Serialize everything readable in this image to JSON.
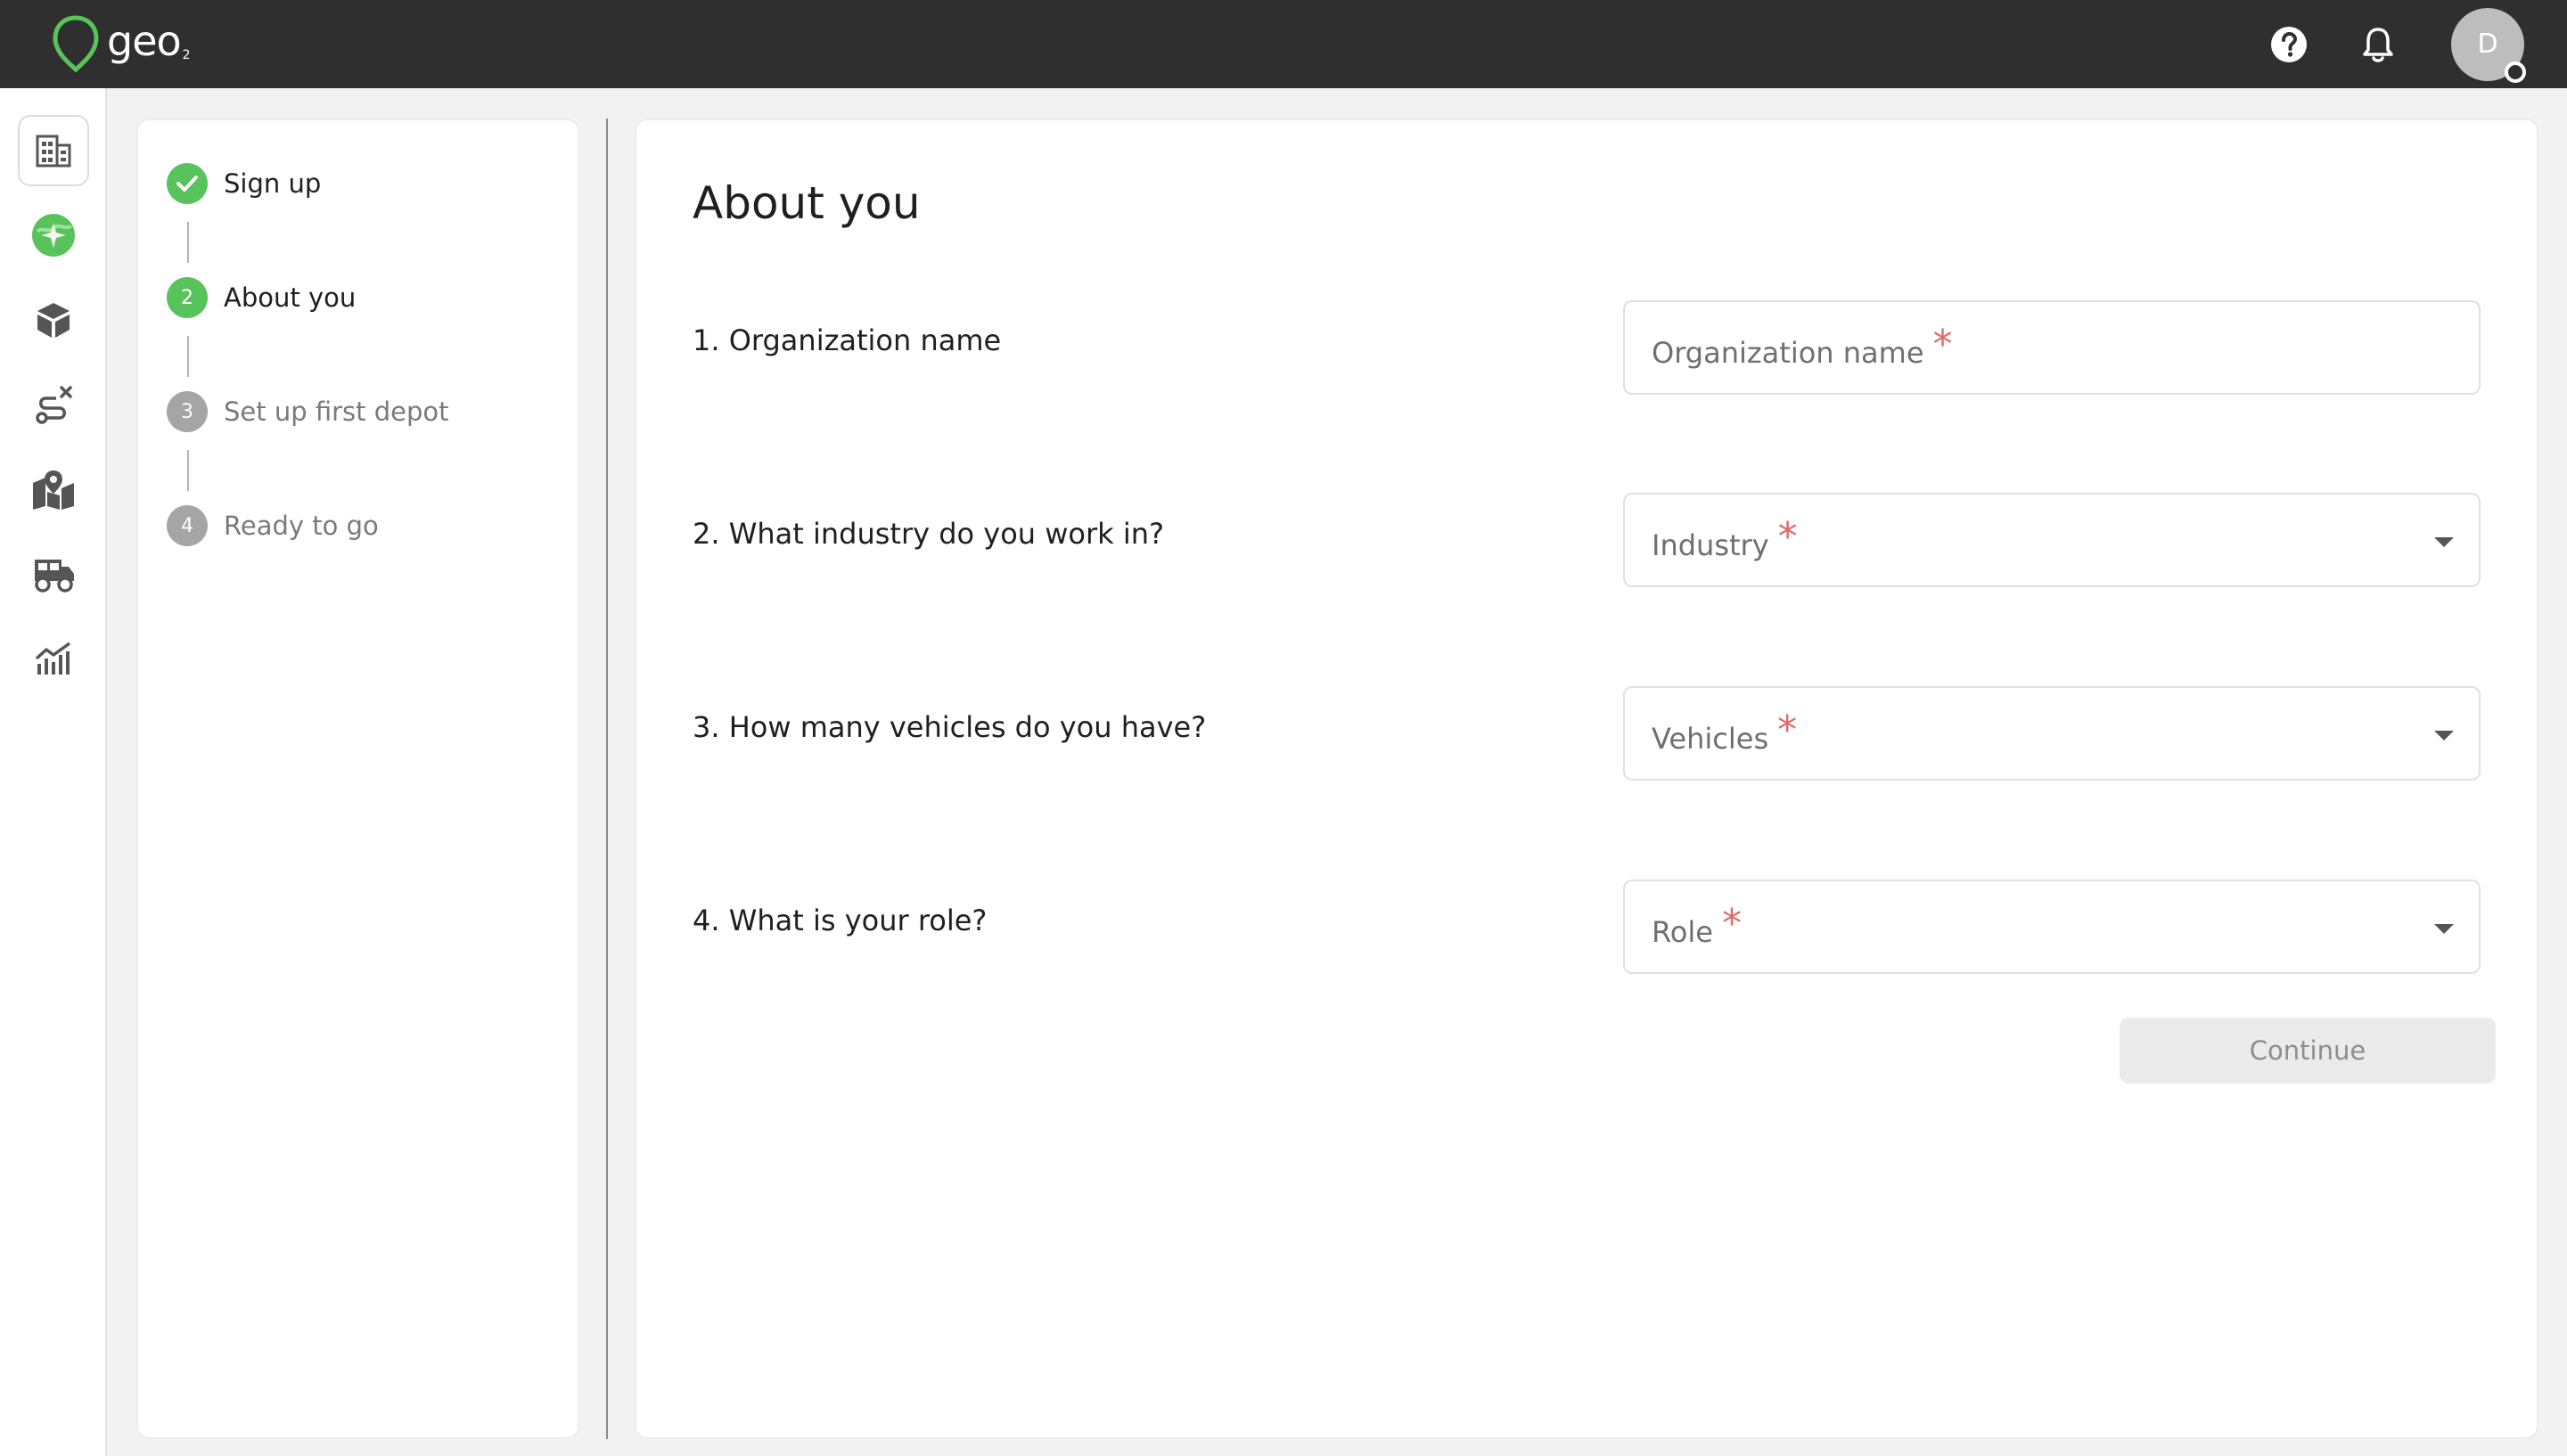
{
  "app": {
    "logo_text": "geo",
    "logo_sub": "2",
    "brand_color": "#58c35b",
    "topbar_color": "#2f2f2f"
  },
  "header": {
    "help_icon": "help-circle-icon",
    "notifications_icon": "bell-icon",
    "avatar_initial": "D"
  },
  "sidebar": {
    "items": [
      {
        "icon": "building-icon",
        "active": true
      },
      {
        "icon": "globe-sparkle-icon",
        "active": false
      },
      {
        "icon": "package-icon",
        "active": false
      },
      {
        "icon": "route-cancel-icon",
        "active": false
      },
      {
        "icon": "map-pin-icon",
        "active": false
      },
      {
        "icon": "truck-icon",
        "active": false
      },
      {
        "icon": "analytics-chart-icon",
        "active": false
      }
    ]
  },
  "steps": [
    {
      "number": "1",
      "label": "Sign up",
      "status": "done"
    },
    {
      "number": "2",
      "label": "About you",
      "status": "current"
    },
    {
      "number": "3",
      "label": "Set up first depot",
      "status": "todo"
    },
    {
      "number": "4",
      "label": "Ready to go",
      "status": "todo"
    }
  ],
  "main": {
    "title": "About you",
    "questions": [
      {
        "text": "1. Organization name",
        "field_label": "Organization name",
        "type": "text"
      },
      {
        "text": "2. What industry do you work in?",
        "field_label": "Industry",
        "type": "select"
      },
      {
        "text": "3. How many vehicles do you have?",
        "field_label": "Vehicles",
        "type": "select"
      },
      {
        "text": "4. What is your role?",
        "field_label": "Role",
        "type": "select"
      }
    ],
    "required_mark": "*",
    "continue_label": "Continue"
  }
}
